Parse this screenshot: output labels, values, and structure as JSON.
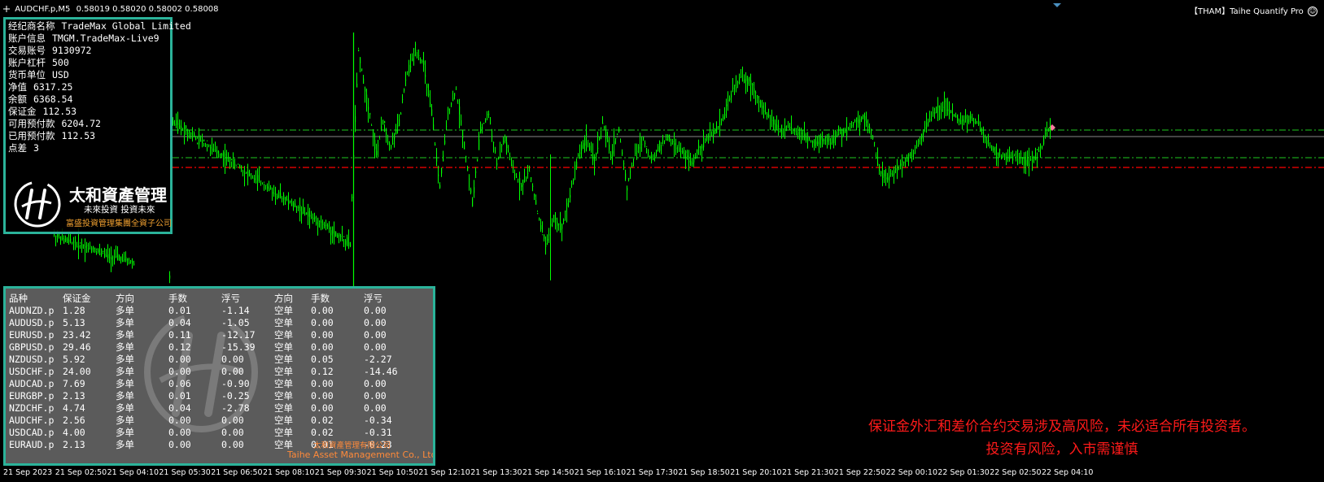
{
  "window": {
    "symbol": "AUDCHF.p,M5",
    "ohlc": "0.58019 0.58020 0.58002 0.58008",
    "indicator_name": "【THAM】Taihe Quantify Pro",
    "indicator_icon": "smiley-icon"
  },
  "account": {
    "rows": [
      {
        "label": "经纪商名称",
        "value": "TradeMax Global Limited"
      },
      {
        "label": "账户信息",
        "value": "TMGM.TradeMax-Live9"
      },
      {
        "label": "交易账号",
        "value": "9130972"
      },
      {
        "label": "账户杠杆",
        "value": "500"
      },
      {
        "label": "货币单位",
        "value": "USD"
      },
      {
        "label": "净值",
        "value": "6317.25"
      },
      {
        "label": "余额",
        "value": "6368.54"
      },
      {
        "label": "保证金",
        "value": "112.53"
      },
      {
        "label": "可用预付款",
        "value": "6204.72"
      },
      {
        "label": "已用预付款",
        "value": "112.53"
      },
      {
        "label": "点差",
        "value": "3"
      }
    ],
    "logo": {
      "name": "太和資產管理",
      "slogan": "未來投資  投資未來",
      "sub": "富盛投資管理集團全資子公司"
    }
  },
  "positions": {
    "headers": [
      "品种",
      "保证金",
      "方向",
      "手数",
      "浮亏",
      "方向",
      "手数",
      "浮亏"
    ],
    "rows": [
      [
        "AUDNZD.p",
        "1.28",
        "多单",
        "0.01",
        "-1.14",
        "空单",
        "0.00",
        "0.00"
      ],
      [
        "AUDUSD.p",
        "5.13",
        "多单",
        "0.04",
        "-1.05",
        "空单",
        "0.00",
        "0.00"
      ],
      [
        "EURUSD.p",
        "23.42",
        "多单",
        "0.11",
        "-12.17",
        "空单",
        "0.00",
        "0.00"
      ],
      [
        "GBPUSD.p",
        "29.46",
        "多单",
        "0.12",
        "-15.39",
        "空单",
        "0.00",
        "0.00"
      ],
      [
        "NZDUSD.p",
        "5.92",
        "多单",
        "0.00",
        "0.00",
        "空单",
        "0.05",
        "-2.27"
      ],
      [
        "USDCHF.p",
        "24.00",
        "多单",
        "0.00",
        "0.00",
        "空单",
        "0.12",
        "-14.46"
      ],
      [
        "AUDCAD.p",
        "7.69",
        "多单",
        "0.06",
        "-0.90",
        "空单",
        "0.00",
        "0.00"
      ],
      [
        "EURGBP.p",
        "2.13",
        "多单",
        "0.01",
        "-0.25",
        "空单",
        "0.00",
        "0.00"
      ],
      [
        "NZDCHF.p",
        "4.74",
        "多单",
        "0.04",
        "-2.78",
        "空单",
        "0.00",
        "0.00"
      ],
      [
        "AUDCHF.p",
        "2.56",
        "多单",
        "0.00",
        "0.00",
        "空单",
        "0.02",
        "-0.34"
      ],
      [
        "USDCAD.p",
        "4.00",
        "多单",
        "0.00",
        "0.00",
        "空单",
        "0.02",
        "-0.31"
      ],
      [
        "EURAUD.p",
        "2.13",
        "多单",
        "0.00",
        "0.00",
        "空单",
        "0.01",
        "-0.23"
      ]
    ],
    "footer_cn": "太和資產管理有限公司",
    "footer_en": "Taihe Asset Management Co., Ltd"
  },
  "risk_warning": {
    "line1": "保证金外汇和差价合约交易涉及高风险，未必适合所有投资者。",
    "line2": "投资有风险，入市需谨慎"
  },
  "time_axis": [
    "21 Sep 2023",
    "21 Sep 02:50",
    "21 Sep 04:10",
    "21 Sep 05:30",
    "21 Sep 06:50",
    "21 Sep 08:10",
    "21 Sep 09:30",
    "21 Sep 10:50",
    "21 Sep 12:10",
    "21 Sep 13:30",
    "21 Sep 14:50",
    "21 Sep 16:10",
    "21 Sep 17:30",
    "21 Sep 18:50",
    "21 Sep 20:10",
    "21 Sep 21:30",
    "21 Sep 22:50",
    "22 Sep 00:10",
    "22 Sep 01:30",
    "22 Sep 02:50",
    "22 Sep 04:10"
  ],
  "colors": {
    "background": "#000000",
    "candles": "#00ff00",
    "panel_border": "#2bb39a",
    "level_green": "#1fc71f",
    "level_red": "#ff0000",
    "bid_line": "#888888",
    "warning_text": "#ff1a1a",
    "logo_sub": "#f0a030"
  }
}
